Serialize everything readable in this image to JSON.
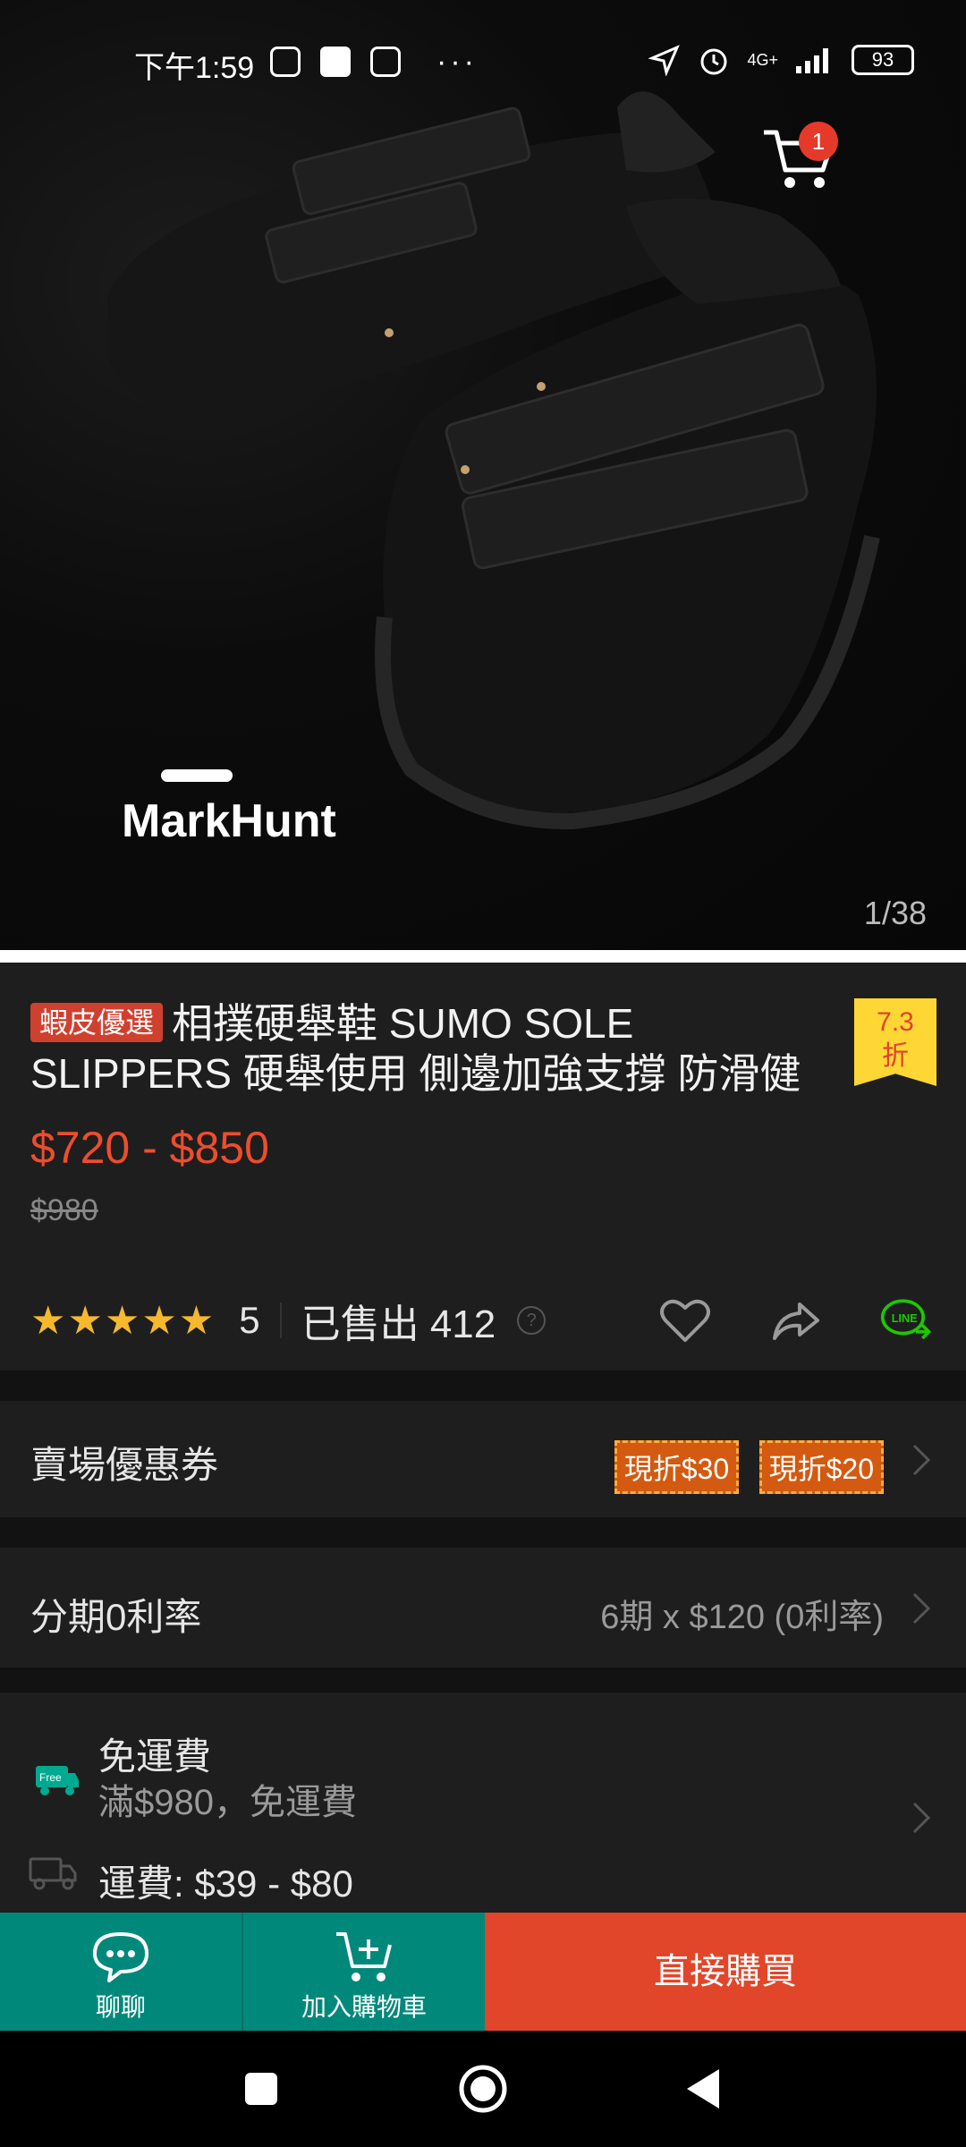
{
  "status_bar": {
    "time": "下午1:59",
    "network": "4G+",
    "battery": "93"
  },
  "gallery": {
    "counter": "1/38",
    "cart_badge": "1",
    "brand_watermark": "MarkHunt"
  },
  "product": {
    "mall_tag": "蝦皮優選",
    "title": "相撲硬舉鞋 SUMO SOLE SLIPPERS 硬舉使用 側邊加強支撐 防滑健",
    "discount_line1": "7.3",
    "discount_line2": "折",
    "price_range": "$720 - $850",
    "original_price": "$980",
    "rating": "5",
    "sold": "已售出 412",
    "stars": "★★★★★"
  },
  "sections": {
    "coupons": {
      "label": "賣場優惠券",
      "items": [
        "現折$30",
        "現折$20"
      ]
    },
    "installment": {
      "label": "分期0利率",
      "value": "6期 x $120 (0利率)"
    },
    "shipping": {
      "free_title": "免運費",
      "free_sub": "滿$980，免運費",
      "fee": "運費: $39 - $80",
      "free_badge": "Free"
    }
  },
  "bottom_bar": {
    "chat": "聊聊",
    "add_to_cart": "加入購物車",
    "buy_now": "直接購買"
  },
  "colors": {
    "accent": "#ee4d2d",
    "teal": "#00897b",
    "star": "#f5b82e",
    "line_green": "#1ec800"
  }
}
